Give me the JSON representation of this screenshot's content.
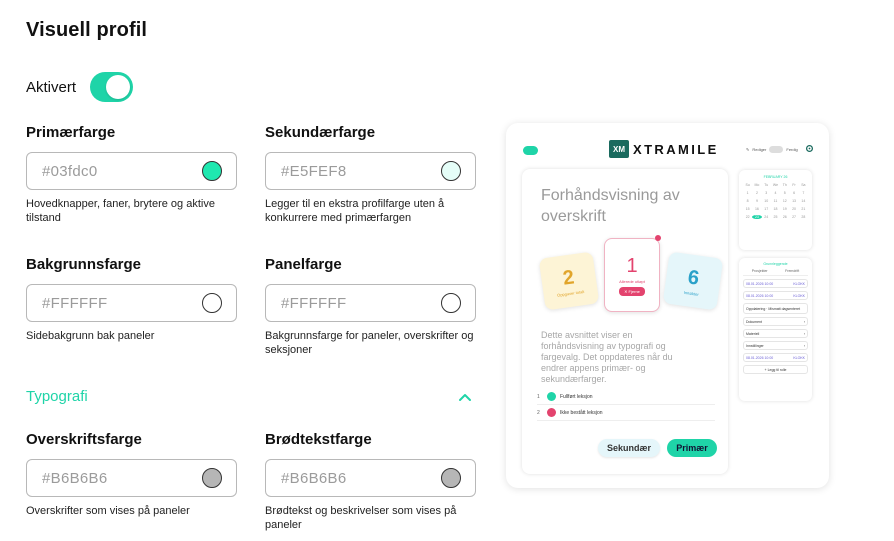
{
  "page": {
    "title": "Visuell profil"
  },
  "enabled": {
    "label": "Aktivert",
    "value": true,
    "color": "#1fd4a8"
  },
  "fields": {
    "primary": {
      "label": "Primærfarge",
      "value": "#03fdc0",
      "swatch": "#1fe8b0",
      "help": "Hovedknapper, faner, brytere og aktive tilstand"
    },
    "secondary": {
      "label": "Sekundærfarge",
      "value": "#E5FEF8",
      "swatch": "#e5fef8",
      "help": "Legger til en ekstra profilfarge uten å konkurrere med primærfargen"
    },
    "background": {
      "label": "Bakgrunnsfarge",
      "value": "#FFFFFF",
      "swatch": "#ffffff",
      "help": "Sidebakgrunn bak paneler"
    },
    "panel": {
      "label": "Panelfarge",
      "value": "#FFFFFF",
      "swatch": "#ffffff",
      "help": "Bakgrunnsfarge for paneler, overskrifter og seksjoner"
    },
    "heading": {
      "label": "Overskriftsfarge",
      "value": "#B6B6B6",
      "swatch": "#b6b6b6",
      "help": "Overskrifter som vises på paneler"
    },
    "body": {
      "label": "Brødtekstfarge",
      "value": "#B6B6B6",
      "swatch": "#b6b6b6",
      "help": "Brødtekst og beskrivelser som vises på paneler"
    }
  },
  "typography": {
    "title": "Typografi",
    "expanded": true,
    "icon": "chevron-up-icon"
  },
  "preview": {
    "logo_mark": "XM",
    "logo_text": "XTRAMILE",
    "edit_label": "Rediger",
    "edit_toggle_label": "Ferdig",
    "heading": "Forhåndsvisning av overskrift",
    "body": "Dette avsnittet viser en forhåndsvisning av typografi og fargevalg. Det oppdateres når du endrer appens primær- og sekundærfarger.",
    "cards": [
      {
        "number": "2",
        "label": "Oppgaver totalt",
        "color": "#e1a52b"
      },
      {
        "number": "1",
        "label": "Allerede utløpt",
        "chip": "✕ Fjerne",
        "color": "#e3436e"
      },
      {
        "number": "6",
        "label": "Innsikter",
        "color": "#2aa1c9"
      }
    ],
    "list": [
      {
        "index": "1",
        "label": "Fullført leksjon",
        "status_color": "#1fd4a8"
      },
      {
        "index": "2",
        "label": "Ikke bestått leksjon",
        "status_color": "#e3436e"
      }
    ],
    "buttons": {
      "secondary": "Sekundær",
      "primary": "Primær"
    },
    "calendar": {
      "title": "FEBRUARY 26",
      "weekdays": [
        "Su",
        "Mo",
        "Tu",
        "We",
        "Th",
        "Fr",
        "Sa"
      ],
      "days": [
        "1",
        "2",
        "3",
        "4",
        "5",
        "6",
        "7",
        "8",
        "9",
        "10",
        "11",
        "12",
        "13",
        "14",
        "15",
        "16",
        "17",
        "18",
        "19",
        "20",
        "21",
        "22",
        "23",
        "24",
        "25",
        "26",
        "27",
        "28"
      ],
      "today": "23"
    },
    "panel": {
      "title": "Grunnleggende",
      "tabs": [
        "Prosjekter",
        "Fremdrift"
      ],
      "rows": [
        {
          "left": "08.01.2026 10:00",
          "right": "KLOKK",
          "type": "date"
        },
        {
          "left": "08.01.2026 10:00",
          "right": "KLOKK",
          "type": "date"
        },
        {
          "left": "Oppdatering · Mismatt dagsenteret",
          "right": "",
          "type": "tall"
        },
        {
          "left": "Dokument",
          "right": "›",
          "type": "item"
        },
        {
          "left": "Materiell",
          "right": "›",
          "type": "item"
        },
        {
          "left": "Innstillinger",
          "right": "›",
          "type": "item"
        },
        {
          "left": "08.01.2026 10:00",
          "right": "KLOKK",
          "type": "date"
        }
      ],
      "add_label": "+ Legg til rolle"
    }
  }
}
